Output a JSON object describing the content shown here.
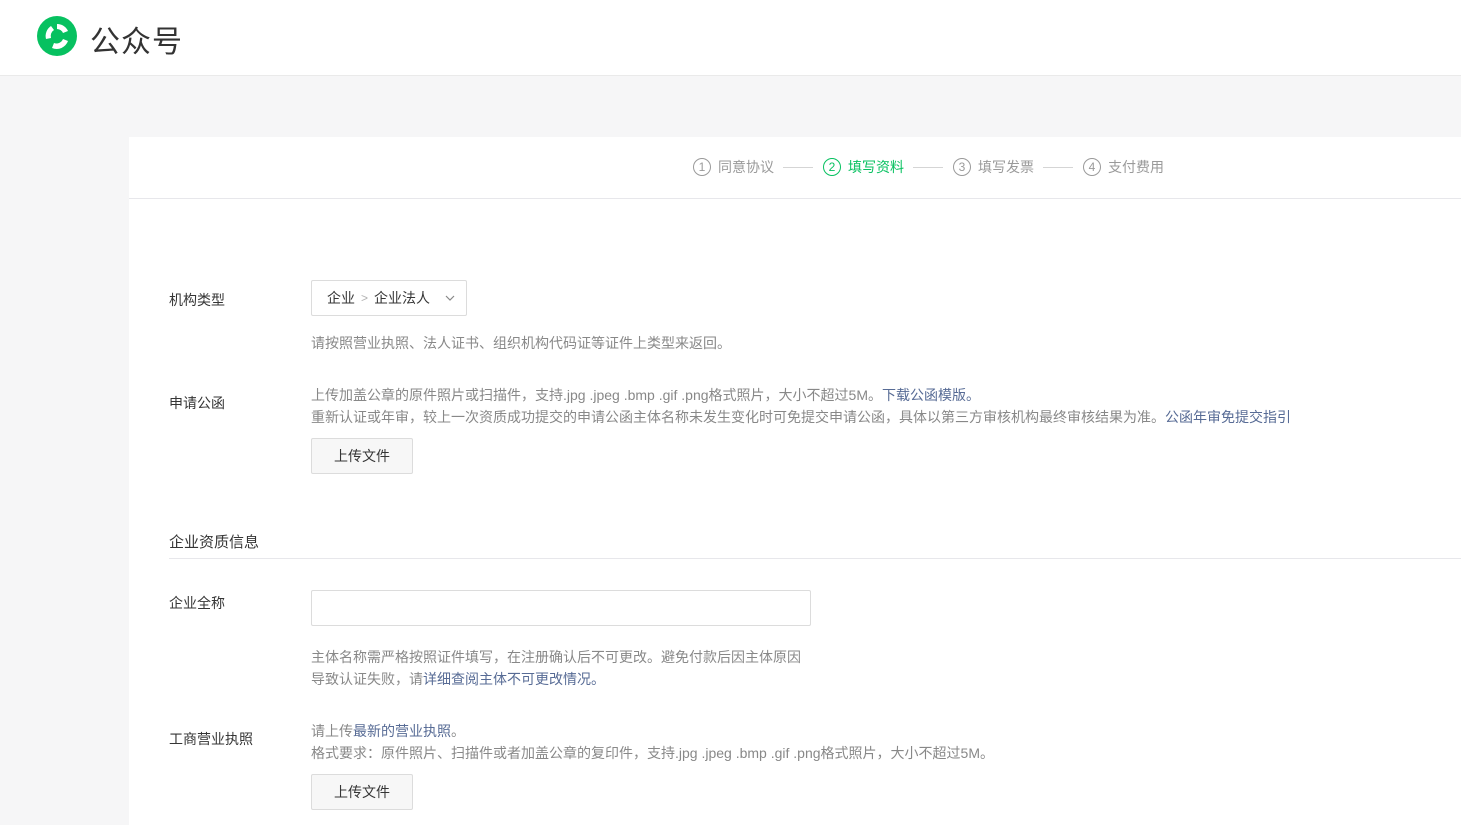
{
  "brand": {
    "name": "公众号",
    "logo_icon": "wechat-official-account-logo-icon",
    "color": "#07c160"
  },
  "steps": [
    {
      "num": "1",
      "label": "同意协议"
    },
    {
      "num": "2",
      "label": "填写资料"
    },
    {
      "num": "3",
      "label": "填写发票"
    },
    {
      "num": "4",
      "label": "支付费用"
    }
  ],
  "active_step": 2,
  "org_type": {
    "label": "机构类型",
    "selected_primary": "企业",
    "selected_secondary": "企业法人",
    "tip": "请按照营业执照、法人证书、组织机构代码证等证件上类型来返回。"
  },
  "letter": {
    "label": "申请公函",
    "tip1_text": "上传加盖公章的原件照片或扫描件，支持.jpg .jpeg .bmp .gif .png格式照片，大小不超过5M。",
    "tip1_link": "下载公函模版。",
    "tip2_text": "重新认证或年审，较上一次资质成功提交的申请公函主体名称未发生变化时可免提交申请公函，具体以第三方审核机构最终审核结果为准。",
    "tip2_link": "公函年审免提交指引",
    "upload_label": "上传文件"
  },
  "section": {
    "title": "企业资质信息"
  },
  "company_name": {
    "label": "企业全称",
    "value": "",
    "placeholder": "",
    "tip1": "主体名称需严格按照证件填写，在注册确认后不可更改。避免付款后因主体原因",
    "tip2_text": "导致认证失败，请",
    "tip2_link": "详细查阅主体不可更改情况。"
  },
  "license": {
    "label": "工商营业执照",
    "tip1_text": "请上传",
    "tip1_link": "最新的营业执照",
    "tip1_end": "。",
    "tip2": "格式要求：原件照片、扫描件或者加盖公章的复印件，支持.jpg .jpeg .bmp .gif .png格式照片，大小不超过5M。",
    "upload_label": "上传文件"
  }
}
